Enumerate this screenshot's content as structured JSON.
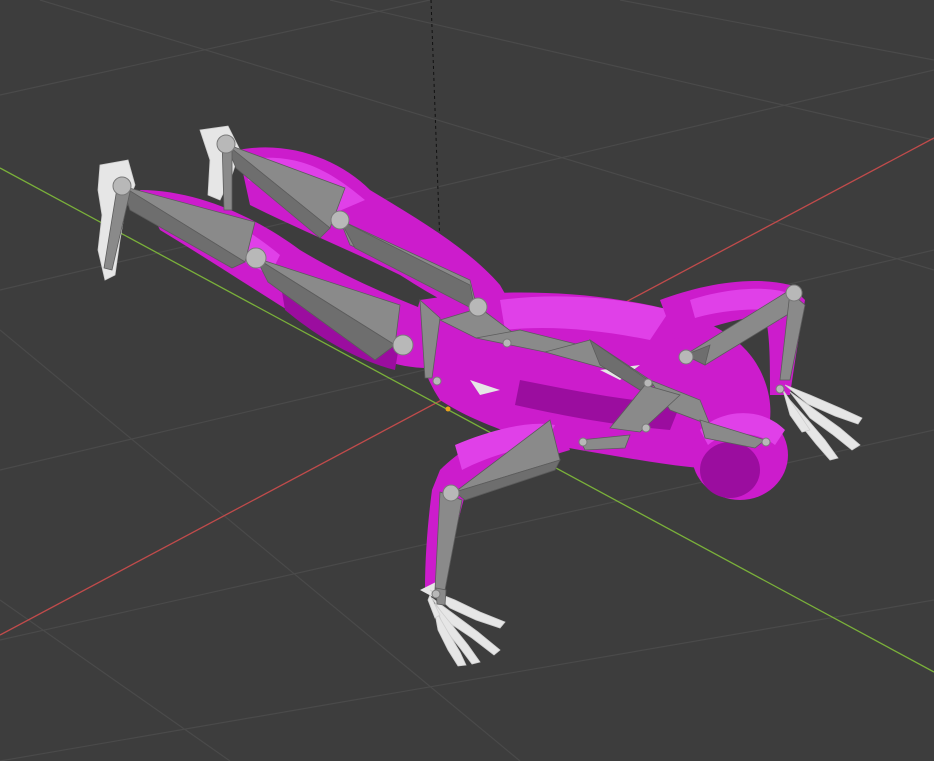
{
  "viewport": {
    "background_color": "#3d3d3d",
    "grid_color": "#4a4a4a",
    "x_axis_color": "#c04b4b",
    "y_axis_color": "#7ab03a",
    "z_axis_color": "#1e1e1e",
    "origin_color": "#e9a21c",
    "muscle_color": "#cc1ccc",
    "muscle_dark_color": "#9b0d9f",
    "muscle_light_color": "#e040e8",
    "bone_color": "#e6e6e6",
    "armature_color": "#8a8a8a",
    "armature_dark_color": "#6e6e6e",
    "joint_color": "#b8b8b8"
  },
  "scene": {
    "object_type": "armature-with-muscle-mesh",
    "pose": "push-up",
    "shading": "solid"
  }
}
